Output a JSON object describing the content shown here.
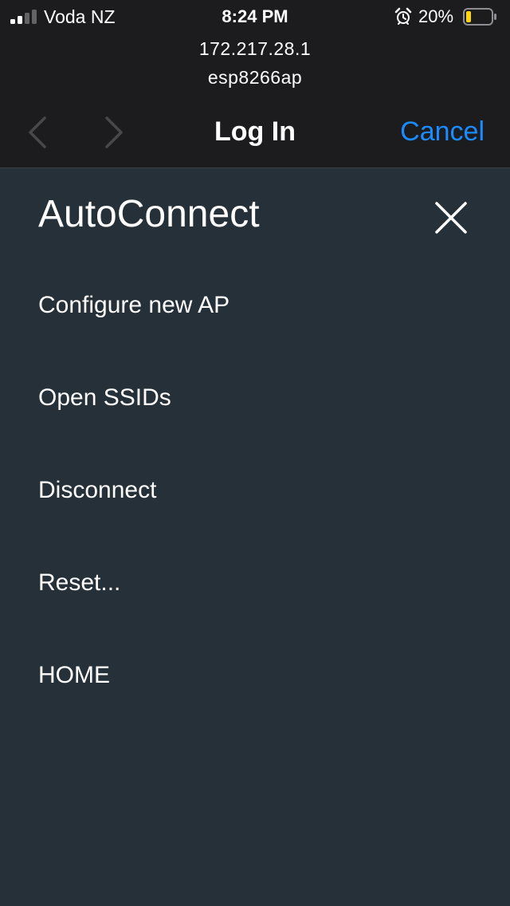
{
  "status_bar": {
    "carrier": "Voda NZ",
    "time": "8:24 PM",
    "battery_percent": "20%",
    "battery_level": 0.2,
    "signal_bars_active": 2,
    "signal_bars_total": 4
  },
  "header": {
    "host": "172.217.28.1",
    "ssid": "esp8266ap",
    "title": "Log In",
    "cancel_label": "Cancel",
    "accent_color": "#1a8cff"
  },
  "panel": {
    "title": "AutoConnect",
    "background_color": "#263038",
    "menu": [
      {
        "label": "Configure new AP"
      },
      {
        "label": "Open SSIDs"
      },
      {
        "label": "Disconnect"
      },
      {
        "label": "Reset..."
      },
      {
        "label": "HOME"
      }
    ]
  },
  "icons": {
    "signal": "cellular-signal-icon",
    "alarm": "alarm-clock-icon",
    "battery": "battery-icon",
    "back": "chevron-left-icon",
    "forward": "chevron-right-icon",
    "close": "close-icon"
  }
}
